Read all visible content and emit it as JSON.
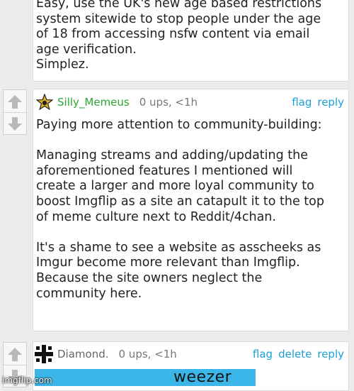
{
  "comment_prev": {
    "text": "Easy, use the UK's new age based restrictions\nsystem sitewide to stop people under the age\nof 18 from accessing nsfw content via email\nage verification.\nSimplez."
  },
  "comment_1": {
    "username": "Silly_Memeus",
    "meta": "0 ups, <1h",
    "flag": "flag",
    "reply": "reply",
    "text": "Paying more attention to community-building:\n\nManaging streams and adding/updating the\naforementioned features I mentioned will\ncreate a larger and more loyal community to\nboost Imgflip as a site an catapult it to the top\nof meme culture next to Reddit/4chan.\n\nIt's a shame to see a website as asscheeks as\nImgur become more relevant than Imgflip.\nBecause the site owners neglect the\ncommunity here."
  },
  "comment_2": {
    "username": "Diamond.",
    "meta": "0 ups, <1h",
    "flag": "flag",
    "delete": "delete",
    "reply": "reply",
    "image_text": "weezer"
  },
  "watermark": "imgflip.com",
  "colors": {
    "link": "#1b9fd6",
    "username_green": "#2aa834",
    "weezer_bg": "#3cb6e9"
  }
}
